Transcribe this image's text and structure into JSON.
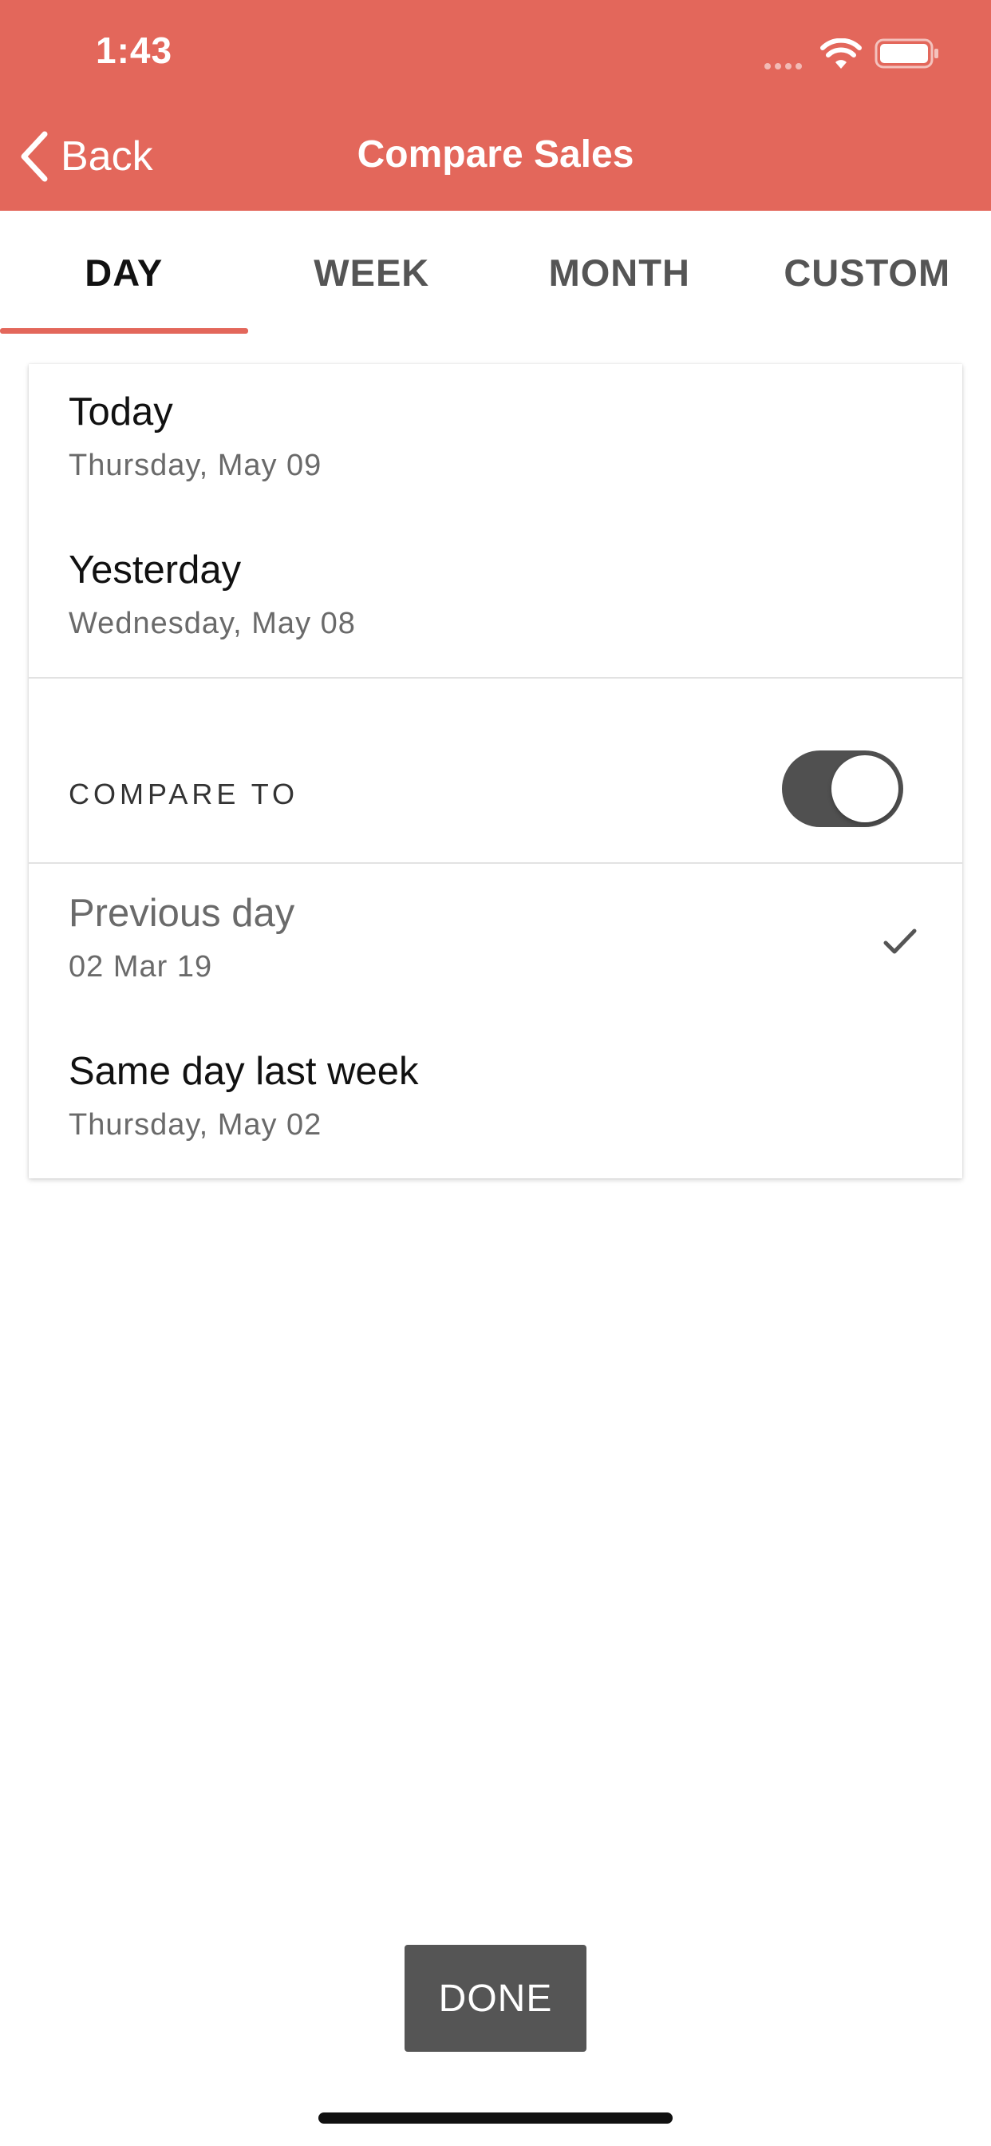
{
  "status_bar": {
    "time": "1:43",
    "icons": [
      "signal-icon",
      "wifi-icon",
      "battery-icon"
    ]
  },
  "header": {
    "back_label": "Back",
    "title": "Compare Sales",
    "background_color": "#e3675b"
  },
  "tabs": [
    {
      "label": "DAY",
      "active": true
    },
    {
      "label": "WEEK",
      "active": false
    },
    {
      "label": "MONTH",
      "active": false
    },
    {
      "label": "CUSTOM",
      "active": false
    }
  ],
  "periods": [
    {
      "title": "Today",
      "subtitle": "Thursday, May 09"
    },
    {
      "title": "Yesterday",
      "subtitle": "Wednesday, May 08"
    }
  ],
  "compare": {
    "label": "COMPARE TO",
    "enabled": true,
    "options": [
      {
        "title": "Previous day",
        "subtitle": "02 Mar 19",
        "selected": true
      },
      {
        "title": "Same day last week",
        "subtitle": "Thursday, May 02",
        "selected": false
      }
    ]
  },
  "footer": {
    "done_label": "DONE"
  }
}
